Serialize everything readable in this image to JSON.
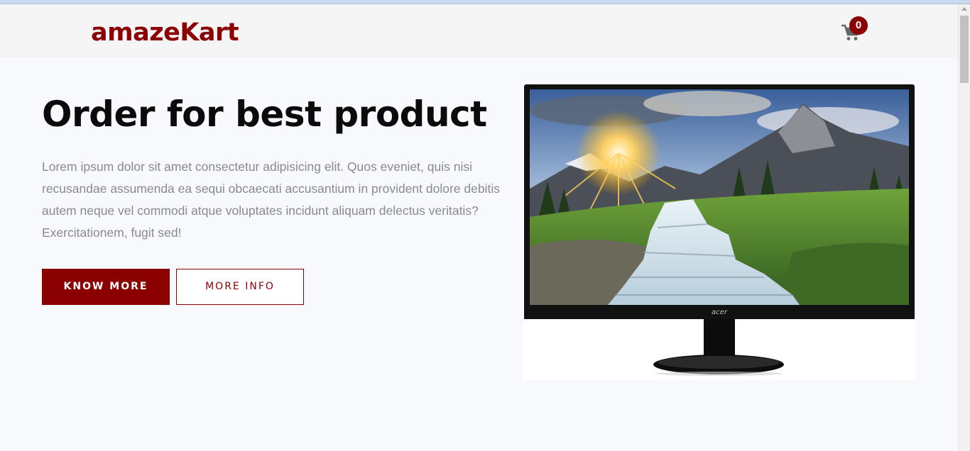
{
  "brand": {
    "name": "amazeKart"
  },
  "cart": {
    "count": "0",
    "icon": "cart-icon"
  },
  "hero": {
    "title": "Order for best product",
    "description": "Lorem ipsum dolor sit amet consectetur adipisicing elit. Quos eveniet, quis nisi recusandae assumenda ea sequi obcaecati accusantium in provident dolore debitis autem neque vel commodi atque voluptates incidunt aliquam delectus veritatis? Exercitationem, fugit sed!",
    "buttons": {
      "primary": "KNOW MORE",
      "secondary": "MORE INFO"
    },
    "image": {
      "monitor_brand": "acer"
    }
  },
  "colors": {
    "accent": "#8b0000",
    "navbar_bg": "#f5f5f5",
    "page_bg": "#f8f9fc",
    "body_text": "#8a8a8a"
  }
}
